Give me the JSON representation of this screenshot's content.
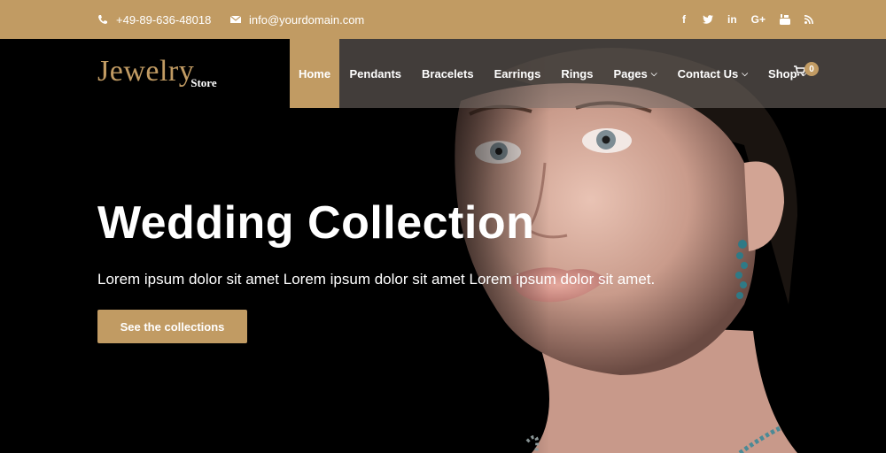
{
  "topbar": {
    "phone": "+49-89-636-48018",
    "email": "info@yourdomain.com",
    "social": [
      {
        "name": "facebook-icon",
        "glyph": "f"
      },
      {
        "name": "twitter-icon",
        "glyph": "t"
      },
      {
        "name": "linkedin-icon",
        "glyph": "in"
      },
      {
        "name": "google-plus-icon",
        "glyph": "G+"
      },
      {
        "name": "youtube-icon",
        "glyph": "▶"
      },
      {
        "name": "rss-icon",
        "glyph": "◉"
      }
    ]
  },
  "logo": {
    "main": "Jewelry",
    "sub": "Store"
  },
  "nav": {
    "home": "Home",
    "pendants": "Pendants",
    "bracelets": "Bracelets",
    "earrings": "Earrings",
    "rings": "Rings",
    "pages": "Pages",
    "contact": "Contact Us",
    "shop": "Shop",
    "cart_count": "0"
  },
  "hero": {
    "title": "Wedding Collection",
    "subtitle": "Lorem ipsum dolor sit amet Lorem ipsum dolor sit amet Lorem ipsum dolor sit amet.",
    "cta": "See the collections"
  },
  "colors": {
    "accent": "#c19b63",
    "background": "#000000",
    "text": "#ffffff"
  }
}
